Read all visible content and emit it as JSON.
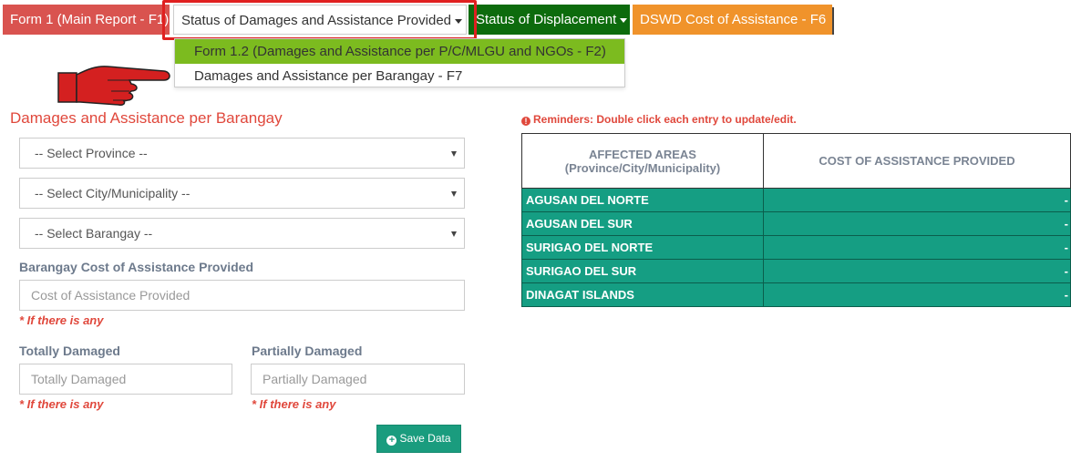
{
  "nav": {
    "tabs": [
      {
        "label": "Form 1 (Main Report - F1)"
      },
      {
        "label": "Status of Damages and Assistance Provided"
      },
      {
        "label": "Status of Displacement"
      },
      {
        "label": "DSWD Cost of Assistance - F6"
      }
    ],
    "menu": [
      {
        "label": "Form 1.2 (Damages and Assistance per P/C/MLGU and NGOs - F2)",
        "active": true
      },
      {
        "label": "Damages and Assistance per Barangay - F7",
        "active": false
      }
    ]
  },
  "form": {
    "title": "Damages and Assistance per Barangay",
    "province_select": "-- Select Province --",
    "city_select": "-- Select City/Municipality --",
    "barangay_select": "-- Select Barangay --",
    "cost_label": "Barangay Cost of Assistance Provided",
    "cost_placeholder": "Cost of Assistance Provided",
    "cost_note": "* If there is any",
    "totally_label": "Totally Damaged",
    "totally_placeholder": "Totally Damaged",
    "totally_note": "* If there is any",
    "partially_label": "Partially Damaged",
    "partially_placeholder": "Partially Damaged",
    "partially_note": "* If there is any",
    "save_label": "Save Data"
  },
  "table": {
    "reminder": "Reminders: Double click each entry to update/edit.",
    "header_col1_line1": "AFFECTED AREAS",
    "header_col1_line2": "(Province/City/Municipality)",
    "header_col2": "COST OF ASSISTANCE PROVIDED",
    "rows": [
      {
        "area": "AGUSAN DEL NORTE",
        "cost": "-"
      },
      {
        "area": "AGUSAN DEL SUR",
        "cost": "-"
      },
      {
        "area": "SURIGAO DEL NORTE",
        "cost": "-"
      },
      {
        "area": "SURIGAO DEL SUR",
        "cost": "-"
      },
      {
        "area": "DINAGAT ISLANDS",
        "cost": "-"
      }
    ]
  },
  "colors": {
    "tab_f1": "#d9534f",
    "tab_displacement": "#0d6b0d",
    "tab_dswd": "#f0932b",
    "menu_active": "#7cbb1f",
    "table_row": "#159e83",
    "accent_red": "#e0483c",
    "highlight": "#e02020"
  },
  "icons": {
    "pointer": "pointing-hand-icon",
    "save": "plus-circle-icon",
    "reminder": "info-circle-icon"
  }
}
